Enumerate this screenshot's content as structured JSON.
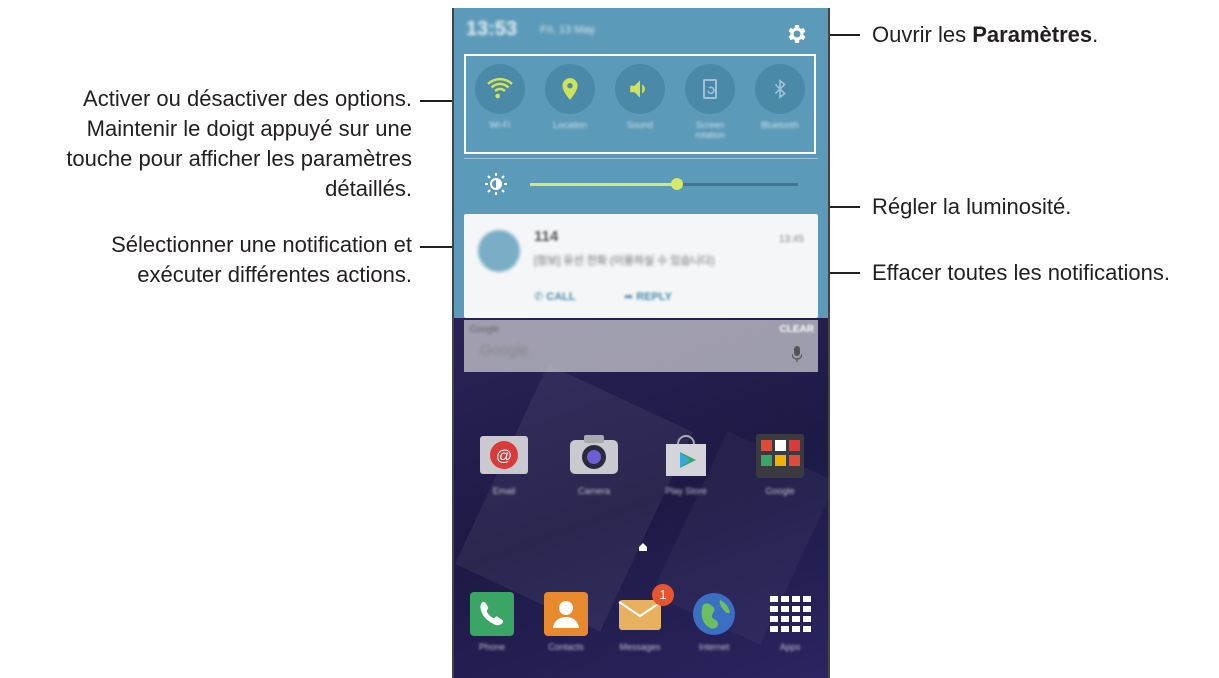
{
  "callouts": {
    "settings_prefix": "Ouvrir les ",
    "settings_bold": "Paramètres",
    "settings_suffix": ".",
    "toggles_line1": "Activer ou désactiver des options.",
    "toggles_line2": "Maintenir le doigt appuyé sur une",
    "toggles_line3": "touche pour afficher les paramètres",
    "toggles_line4": "détaillés.",
    "brightness": "Régler la luminosité.",
    "notification_line1": "Sélectionner une notification et",
    "notification_line2": "exécuter différentes actions.",
    "clear": "Effacer toutes les notifications."
  },
  "status_bar": {
    "time": "13:53",
    "date": "Fri, 13 May"
  },
  "quick_toggles": [
    {
      "label": "Wi-Fi",
      "icon": "wifi-icon",
      "active": true
    },
    {
      "label": "Location",
      "icon": "location-icon",
      "active": true
    },
    {
      "label": "Sound",
      "icon": "sound-icon",
      "active": true
    },
    {
      "label": "Screen rotation",
      "icon": "screen-rotation-icon",
      "active": false
    },
    {
      "label": "Bluetooth",
      "icon": "bluetooth-icon",
      "active": false
    }
  ],
  "brightness": {
    "level": 0.55
  },
  "notification": {
    "title": "114",
    "time": "13:45",
    "text": "[정보] 유선 전화 (이용하실 수 있습니다)",
    "action_call": "CALL",
    "action_reply": "REPLY"
  },
  "search_widget": {
    "label": "Google",
    "placeholder": "Google",
    "clear_label": "CLEAR"
  },
  "apps_row": [
    {
      "label": "Email",
      "icon": "email-icon"
    },
    {
      "label": "Camera",
      "icon": "camera-icon"
    },
    {
      "label": "Play Store",
      "icon": "play-store-icon"
    },
    {
      "label": "Google",
      "icon": "google-folder-icon"
    }
  ],
  "dock": [
    {
      "label": "Phone",
      "icon": "phone-icon"
    },
    {
      "label": "Contacts",
      "icon": "contacts-icon"
    },
    {
      "label": "Messages",
      "icon": "messages-icon",
      "badge": "1"
    },
    {
      "label": "Internet",
      "icon": "internet-icon"
    },
    {
      "label": "Apps",
      "icon": "apps-grid-icon"
    }
  ],
  "colors": {
    "shade": "#5b9ab8",
    "toggle_active_icon": "#cfe25a",
    "slider": "#d7e86b",
    "badge": "#e8542e"
  }
}
